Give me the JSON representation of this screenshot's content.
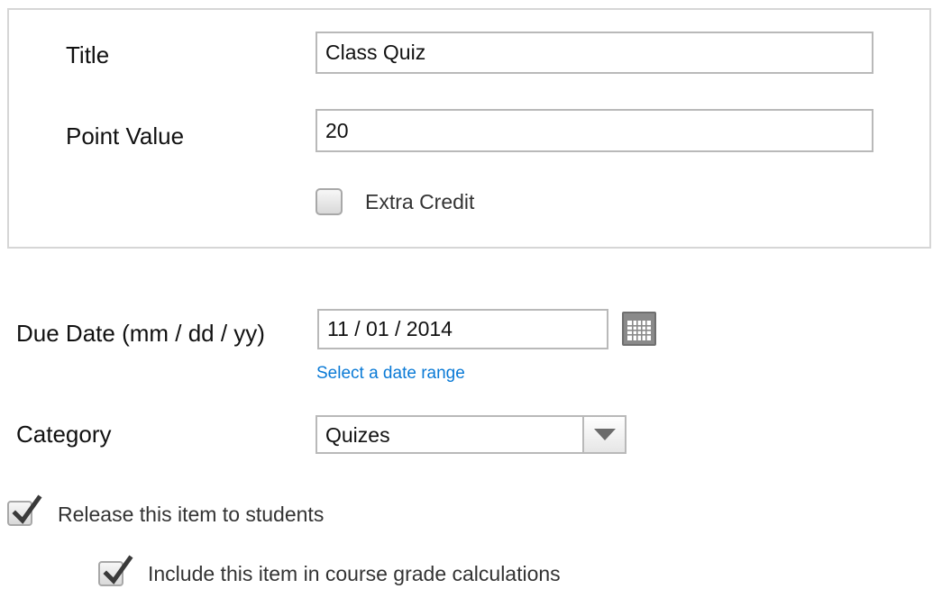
{
  "form": {
    "title": {
      "label": "Title",
      "value": "Class Quiz"
    },
    "point_value": {
      "label": "Point Value",
      "value": "20"
    },
    "extra_credit": {
      "label": "Extra Credit",
      "checked": false
    },
    "due_date": {
      "label": "Due Date (mm / dd / yy)",
      "value": "11 / 01 / 2014",
      "calendar_icon": "calendar-grid-icon",
      "range_link": "Select a date range"
    },
    "category": {
      "label": "Category",
      "selected": "Quizes",
      "arrow_icon": "chevron-down-icon"
    },
    "release_to_students": {
      "label": "Release this item to students",
      "checked": true
    },
    "include_in_grade": {
      "label": "Include this item in course grade calculations",
      "checked": true
    }
  },
  "colors": {
    "link": "#0a7ad6",
    "panel_border": "#d6d6d6",
    "input_border": "#b9b9b9",
    "calendar_button": "#8a8a8a",
    "checkmark": "#3a3a3a"
  }
}
